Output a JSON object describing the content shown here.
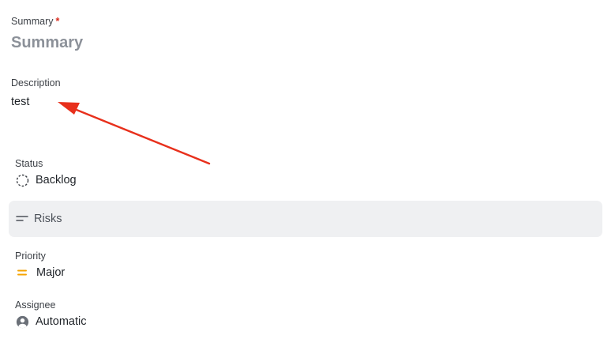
{
  "summary": {
    "label": "Summary",
    "required_marker": "*",
    "placeholder": "Summary",
    "value": ""
  },
  "description": {
    "label": "Description",
    "value": "test"
  },
  "annotation": {
    "color": "#e8301c",
    "icon": "arrow-icon"
  },
  "status": {
    "label": "Status",
    "value": "Backlog",
    "icon": "dashed-circle-icon"
  },
  "risks": {
    "label": "Risks",
    "icon": "lines-icon"
  },
  "priority": {
    "label": "Priority",
    "value": "Major",
    "icon": "equals-icon",
    "color": "#f5a300"
  },
  "assignee": {
    "label": "Assignee",
    "value": "Automatic",
    "icon": "user-circle-icon"
  }
}
